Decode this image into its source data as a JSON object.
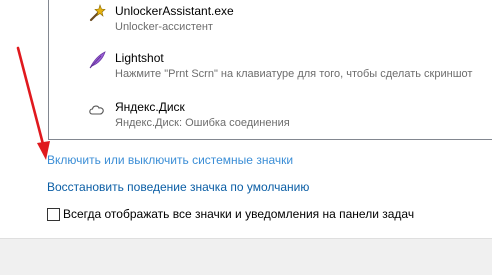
{
  "notification_list": {
    "items": [
      {
        "title": "UnlockerAssistant.exe",
        "subtitle": "Unlocker-ассистент",
        "icon": "wand-icon"
      },
      {
        "title": "Lightshot",
        "subtitle": "Нажмите \"Prnt Scrn\" на клавиатуре для того, чтобы сделать скриншот",
        "icon": "feather-icon"
      },
      {
        "title": "Яндекс.Диск",
        "subtitle": "Яндекс.Диск: Ошибка соединения",
        "icon": "cloud-icon"
      }
    ]
  },
  "links": {
    "toggle_system_icons": "Включить или выключить системные значки",
    "restore_default_behavior": "Восстановить поведение значка по умолчанию"
  },
  "always_show": {
    "label": "Всегда отображать все значки и уведомления на панели задач",
    "checked": false
  },
  "colors": {
    "link": "#0b5ea5",
    "link_hover": "#3b8ed6",
    "annotation_arrow": "#e0191e"
  }
}
